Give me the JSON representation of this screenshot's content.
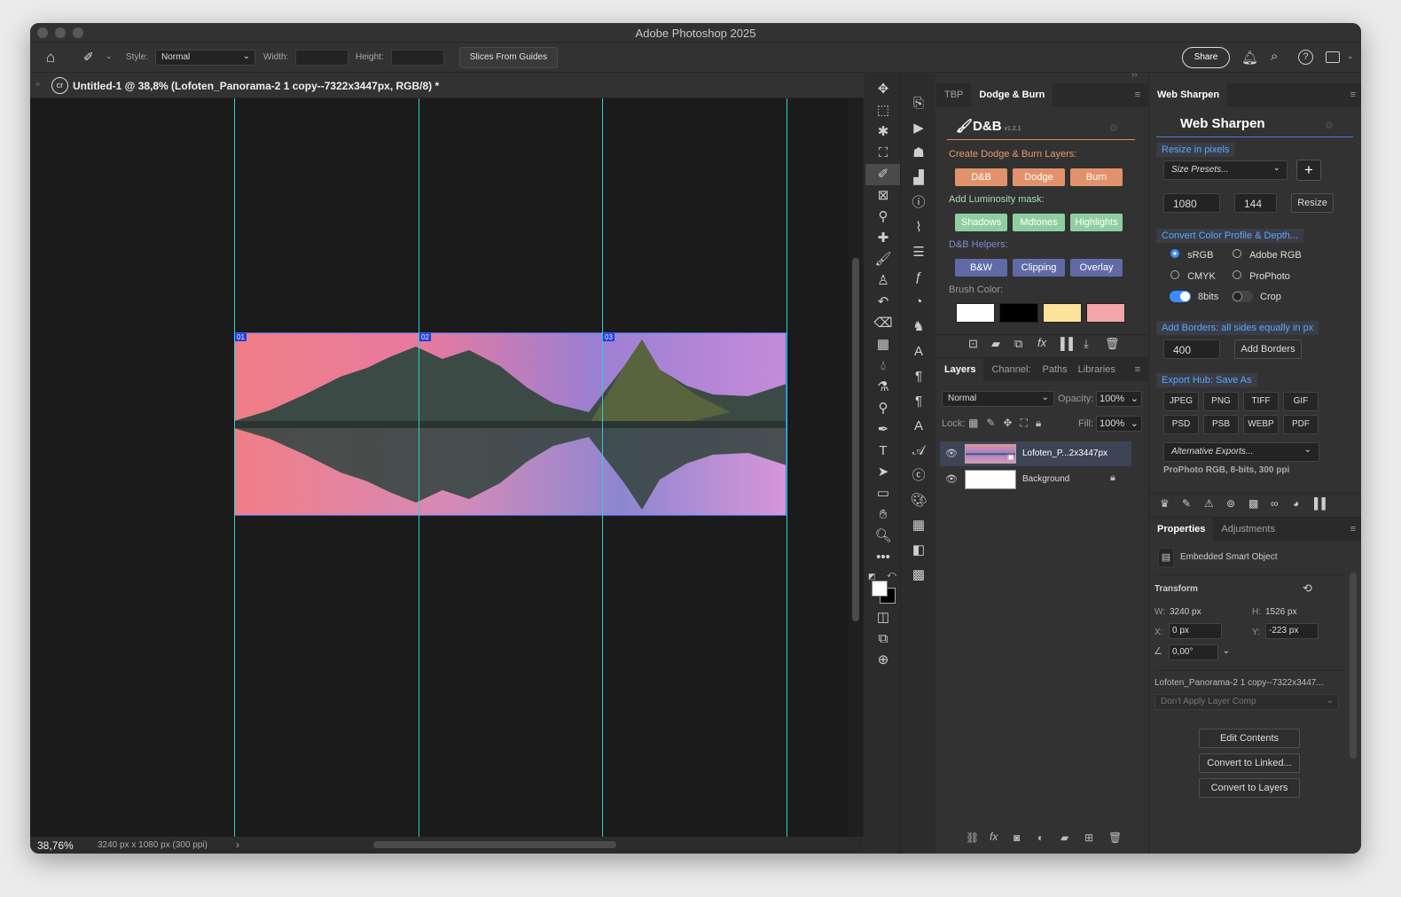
{
  "window": {
    "title": "Adobe Photoshop 2025"
  },
  "options_bar": {
    "style_label": "Style:",
    "style_value": "Normal",
    "width_label": "Width:",
    "height_label": "Height:",
    "slices_button": "Slices From Guides",
    "share_button": "Share"
  },
  "document": {
    "tab_title": "Untitled-1 @ 38,8% (Lofoten_Panorama-2 1 copy--7322x3447px, RGB/8) *",
    "slices": [
      "01",
      "02",
      "03"
    ]
  },
  "status": {
    "zoom": "38,76%",
    "doc_info": "3240 px x 1080 px (300 ppi)",
    "arrow": "›"
  },
  "dodge_burn": {
    "tabs": [
      "TBP",
      "Dodge & Burn"
    ],
    "logo": "D&B",
    "version": "v1.2.1",
    "create_label": "Create Dodge & Burn Layers:",
    "create_buttons": [
      "D&B",
      "Dodge",
      "Burn"
    ],
    "lum_label": "Add Luminosity mask:",
    "lum_buttons": [
      "Shadows",
      "Mdtones",
      "Highlights"
    ],
    "helpers_label": "D&B Helpers:",
    "helper_buttons": [
      "B&W",
      "Clipping",
      "Overlay"
    ],
    "brush_label": "Brush Color:",
    "brush_colors": [
      "#ffffff",
      "#000000",
      "#fce39a",
      "#f4a6a6"
    ]
  },
  "layers": {
    "tabs": [
      "Layers",
      "Channel:",
      "Paths",
      "Libraries"
    ],
    "blend_mode": "Normal",
    "opacity_label": "Opacity:",
    "opacity_value": "100%",
    "lock_label": "Lock:",
    "fill_label": "Fill:",
    "fill_value": "100%",
    "items": [
      {
        "name": "Lofoten_P...2x3447px"
      },
      {
        "name": "Background"
      }
    ]
  },
  "web_sharpen": {
    "tab": "Web Sharpen",
    "title": "Web Sharpen",
    "resize_hdr": "Resize in pixels",
    "size_presets": "Size Presets...",
    "plus": "+",
    "width_val": "1080",
    "sharp_val": "144",
    "resize_btn": "Resize",
    "convert_hdr": "Convert Color Profile & Depth...",
    "profiles": [
      "sRGB",
      "Adobe RGB",
      "CMYK",
      "ProPhoto"
    ],
    "bits_label": "8bits",
    "crop_label": "Crop",
    "borders_hdr": "Add Borders: all sides equally in px",
    "border_val": "400",
    "borders_btn": "Add Borders",
    "export_hdr": "Export Hub: Save As",
    "formats_row1": [
      "JPEG",
      "PNG",
      "TIFF",
      "GIF"
    ],
    "formats_row2": [
      "PSD",
      "PSB",
      "WEBP",
      "PDF"
    ],
    "alt_exports": "Alternative Exports...",
    "profile_info": "ProPhoto RGB, 8-bits, 300 ppi"
  },
  "properties": {
    "tabs": [
      "Properties",
      "Adjustments"
    ],
    "type": "Embedded Smart Object",
    "transform": "Transform",
    "w_label": "W:",
    "w_val": "3240 px",
    "h_label": "H:",
    "h_val": "1526 px",
    "x_label": "X:",
    "x_val": "0 px",
    "y_label": "Y:",
    "y_val": "-223 px",
    "angle": "0,00°",
    "file": "Lofoten_Panorama-2 1 copy--7322x3447...",
    "layer_comp": "Don't Apply Layer Comp",
    "buttons": [
      "Edit Contents",
      "Convert to Linked...",
      "Convert to Layers"
    ]
  }
}
